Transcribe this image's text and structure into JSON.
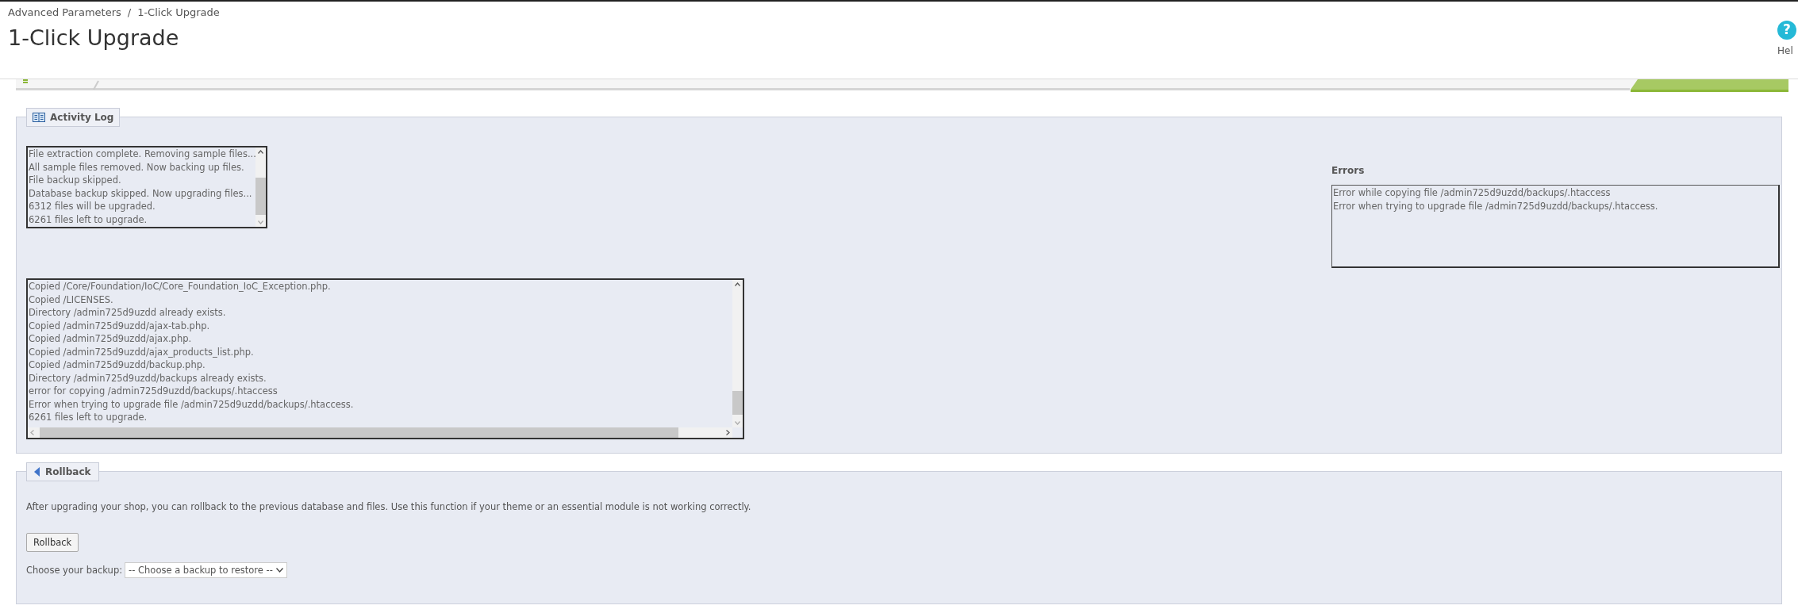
{
  "breadcrumb": [
    "Advanced Parameters",
    "1-Click Upgrade"
  ],
  "breadcrumb_separator": "/",
  "page_title": "1-Click Upgrade",
  "help": {
    "icon": "?",
    "label": "Hel"
  },
  "activity_log": {
    "legend": "Activity Log",
    "summary_lines": [
      "File extraction complete. Removing sample files...",
      "All sample files removed. Now backing up files.",
      "File backup skipped.",
      "Database backup skipped. Now upgrading files...",
      "6312 files will be upgraded.",
      "6261 files left to upgrade."
    ],
    "errors_title": "Errors",
    "errors": [
      "Error while copying file /admin725d9uzdd/backups/.htaccess",
      "Error when trying to upgrade file /admin725d9uzdd/backups/.htaccess."
    ],
    "detail_lines": [
      "Copied /Core/Foundation/IoC/Core_Foundation_IoC_Exception.php.",
      "Copied /LICENSES.",
      "Directory /admin725d9uzdd already exists.",
      "Copied /admin725d9uzdd/ajax-tab.php.",
      "Copied /admin725d9uzdd/ajax.php.",
      "Copied /admin725d9uzdd/ajax_products_list.php.",
      "Copied /admin725d9uzdd/backup.php.",
      "Directory /admin725d9uzdd/backups already exists.",
      "error for copying /admin725d9uzdd/backups/.htaccess",
      "Error when trying to upgrade file /admin725d9uzdd/backups/.htaccess.",
      "6261 files left to upgrade."
    ]
  },
  "rollback": {
    "legend": "Rollback",
    "description": "After upgrading your shop, you can rollback to the previous database and files. Use this function if your theme or an essential module is not working correctly.",
    "button": "Rollback",
    "backup_label": "Choose your backup:",
    "backup_select": "-- Choose a backup to restore --"
  }
}
